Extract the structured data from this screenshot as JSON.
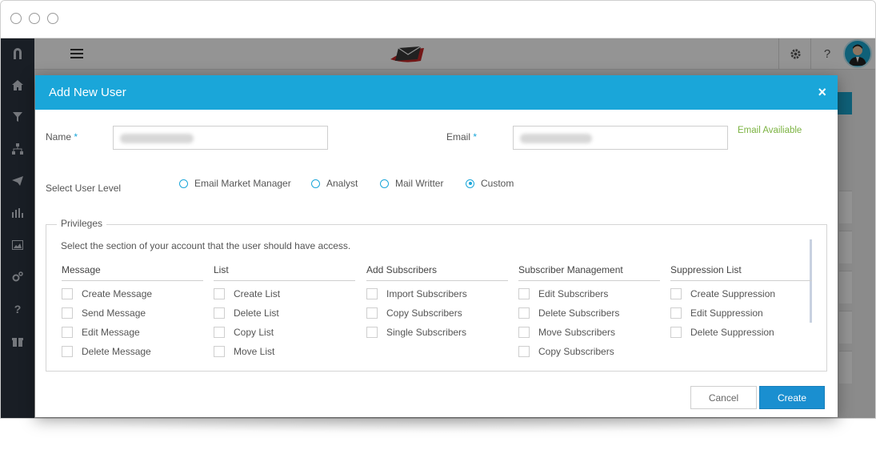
{
  "app": {
    "topbar": {
      "settings_icon": "gear-icon",
      "help_label": "?",
      "avatar_icon": "user-avatar"
    },
    "sidebar": {
      "icons": [
        "magnet-icon",
        "home-icon",
        "filter-icon",
        "sitemap-icon",
        "paper-plane-icon",
        "bar-chart-icon",
        "image-icon",
        "gears-icon",
        "question-icon",
        "gift-icon"
      ]
    }
  },
  "modal": {
    "title": "Add New User",
    "close_label": "×",
    "name": {
      "label": "Name",
      "required_mark": "*",
      "value": ""
    },
    "email": {
      "label": "Email",
      "required_mark": "*",
      "value": "",
      "status": "Email Availiable"
    },
    "user_level": {
      "label": "Select User Level",
      "options": [
        "Email Market Manager",
        "Analyst",
        "Mail Writter",
        "Custom"
      ],
      "selected": "Custom"
    },
    "privileges": {
      "legend": "Privileges",
      "help": "Select the section of your account that the user should have access.",
      "columns": [
        {
          "title": "Message",
          "items": [
            "Create Message",
            "Send Message",
            "Edit Message",
            "Delete Message"
          ]
        },
        {
          "title": "List",
          "items": [
            "Create List",
            "Delete List",
            "Copy List",
            "Move List"
          ]
        },
        {
          "title": "Add Subscribers",
          "items": [
            "Import Subscribers",
            "Copy Subscribers",
            "Single Subscribers"
          ]
        },
        {
          "title": "Subscriber Management",
          "items": [
            "Edit Subscribers",
            "Delete Subscribers",
            "Move Subscribers",
            "Copy Subscribers"
          ]
        },
        {
          "title": "Suppression List",
          "items": [
            "Create Suppression",
            "Edit Suppression",
            "Delete Suppression"
          ]
        }
      ]
    },
    "buttons": {
      "cancel": "Cancel",
      "create": "Create"
    }
  },
  "colors": {
    "accent": "#1aa6d9",
    "sidebar": "#2b3440",
    "success": "#7cb342",
    "primary_button": "#1a8fd0"
  }
}
